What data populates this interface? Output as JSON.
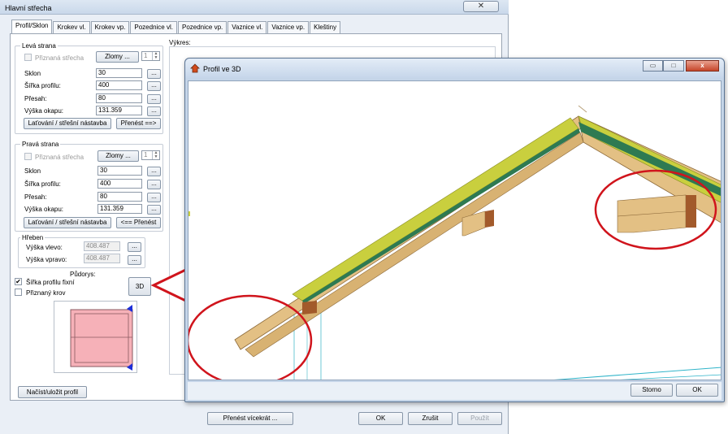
{
  "main_dialog": {
    "title": "Hlavní střecha",
    "close_glyph": "✕",
    "tabs": [
      "Profil/Sklon",
      "Krokev vl.",
      "Krokev vp.",
      "Pozednice vl.",
      "Pozednice vp.",
      "Vaznice vl.",
      "Vaznice vp.",
      "Kleštiny"
    ],
    "active_tab": "Profil/Sklon",
    "drawing_label": "Výkres:",
    "left_side": {
      "title": "Levá strana",
      "fitted_roof_label": "Přiznaná střecha",
      "breaks_button": "Zlomy ...",
      "breaks_count": "1",
      "pitch_label": "Sklon",
      "pitch_value": "30",
      "profile_width_label": "Šířka profilu:",
      "profile_width_value": "400",
      "overhang_label": "Přesah:",
      "overhang_value": "80",
      "eave_height_label": "Výška okapu:",
      "eave_height_value": "131.359",
      "battens_button": "Laťování / střešní nástavba",
      "transfer_button": "Přenést ==>"
    },
    "right_side": {
      "title": "Pravá strana",
      "fitted_roof_label": "Přiznaná střecha",
      "breaks_button": "Zlomy ...",
      "breaks_count": "1",
      "pitch_label": "Sklon",
      "pitch_value": "30",
      "profile_width_label": "Šířka profilu:",
      "profile_width_value": "400",
      "overhang_label": "Přesah:",
      "overhang_value": "80",
      "eave_height_label": "Výška okapu:",
      "eave_height_value": "131.359",
      "battens_button": "Laťování / střešní nástavba",
      "transfer_button": "<== Přenést"
    },
    "ridge": {
      "title": "Hřeben",
      "height_left_label": "Výška vlevo:",
      "height_left_value": "408.487",
      "height_right_label": "Výška vpravo:",
      "height_right_value": "408.487"
    },
    "plan_label": "Půdorys:",
    "fixed_width_label": "Šířka profilu fixní",
    "fixed_width_checked": true,
    "fitted_truss_label": "Přiznaný krov",
    "fitted_truss_checked": false,
    "button_3d": "3D",
    "load_save_button": "Načíst/uložit profil",
    "transfer_multiple_button": "Přenést vícekrát ...",
    "ok_button": "OK",
    "cancel_button": "Zrušit",
    "apply_button": "Použít",
    "dots": "..."
  },
  "window_3d": {
    "title": "Profil ve 3D",
    "minimize_glyph": "▭",
    "maximize_glyph": "□",
    "close_glyph": "x",
    "storno_button": "Storno",
    "ok_button": "OK"
  },
  "colors": {
    "annotation_red": "#d0141c",
    "wood": "#e3c084",
    "wood_dark": "#a86a3b",
    "insulation": "#c9cf3e",
    "foil_green": "#2e7a52",
    "ridge_beam": "#a25a2b",
    "plan_fill": "#f6b1b8"
  }
}
